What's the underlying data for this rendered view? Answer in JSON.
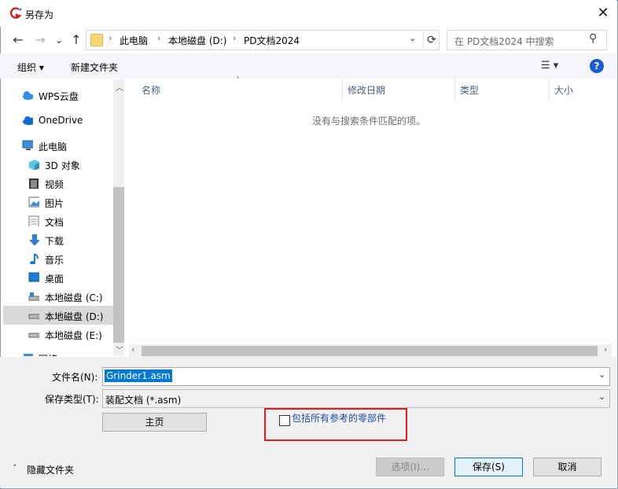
{
  "window": {
    "title": "另存为"
  },
  "nav": {
    "back": "←",
    "forward": "→",
    "dropdown": "⌄",
    "up": "↑"
  },
  "address": {
    "crumbs": [
      "此电脑",
      "本地磁盘 (D:)",
      "PD文档2024"
    ]
  },
  "search": {
    "placeholder": "在 PD文档2024 中搜索"
  },
  "toolbar": {
    "organize": "组织 ▾",
    "new_folder": "新建文件夹"
  },
  "sidebar": {
    "items": [
      {
        "label": "WPS云盘",
        "icon": "cloud-icon"
      },
      {
        "label": "OneDrive",
        "icon": "onedrive-icon"
      },
      {
        "label": "此电脑",
        "icon": "computer-icon"
      },
      {
        "label": "3D 对象",
        "icon": "cube-icon"
      },
      {
        "label": "视频",
        "icon": "video-icon"
      },
      {
        "label": "图片",
        "icon": "picture-icon"
      },
      {
        "label": "文档",
        "icon": "document-icon"
      },
      {
        "label": "下载",
        "icon": "download-icon"
      },
      {
        "label": "音乐",
        "icon": "music-icon"
      },
      {
        "label": "桌面",
        "icon": "desktop-icon"
      },
      {
        "label": "本地磁盘 (C:)",
        "icon": "drive-icon"
      },
      {
        "label": "本地磁盘 (D:)",
        "icon": "drive-icon",
        "selected": true
      },
      {
        "label": "本地磁盘 (E:)",
        "icon": "drive-icon"
      },
      {
        "label": "网络",
        "icon": "network-icon"
      }
    ]
  },
  "columns": [
    "名称",
    "修改日期",
    "类型",
    "大小"
  ],
  "empty_message": "没有与搜索条件匹配的项。",
  "form": {
    "filename_label": "文件名(N):",
    "filename_value": "Grinder1.asm",
    "filetype_label": "保存类型(T):",
    "filetype_value": "装配文档 (*.asm)",
    "home_button": "主页",
    "include_parts_label": "包括所有参考的零部件"
  },
  "footer": {
    "hide_folders": "隐藏文件夹",
    "options_button": "选项(I)...",
    "save_button": "保存(S)",
    "cancel_button": "取消"
  },
  "colors": {
    "accent": "#0078d7",
    "highlight_box": "#e02020",
    "link_text": "#1a4fa0"
  }
}
